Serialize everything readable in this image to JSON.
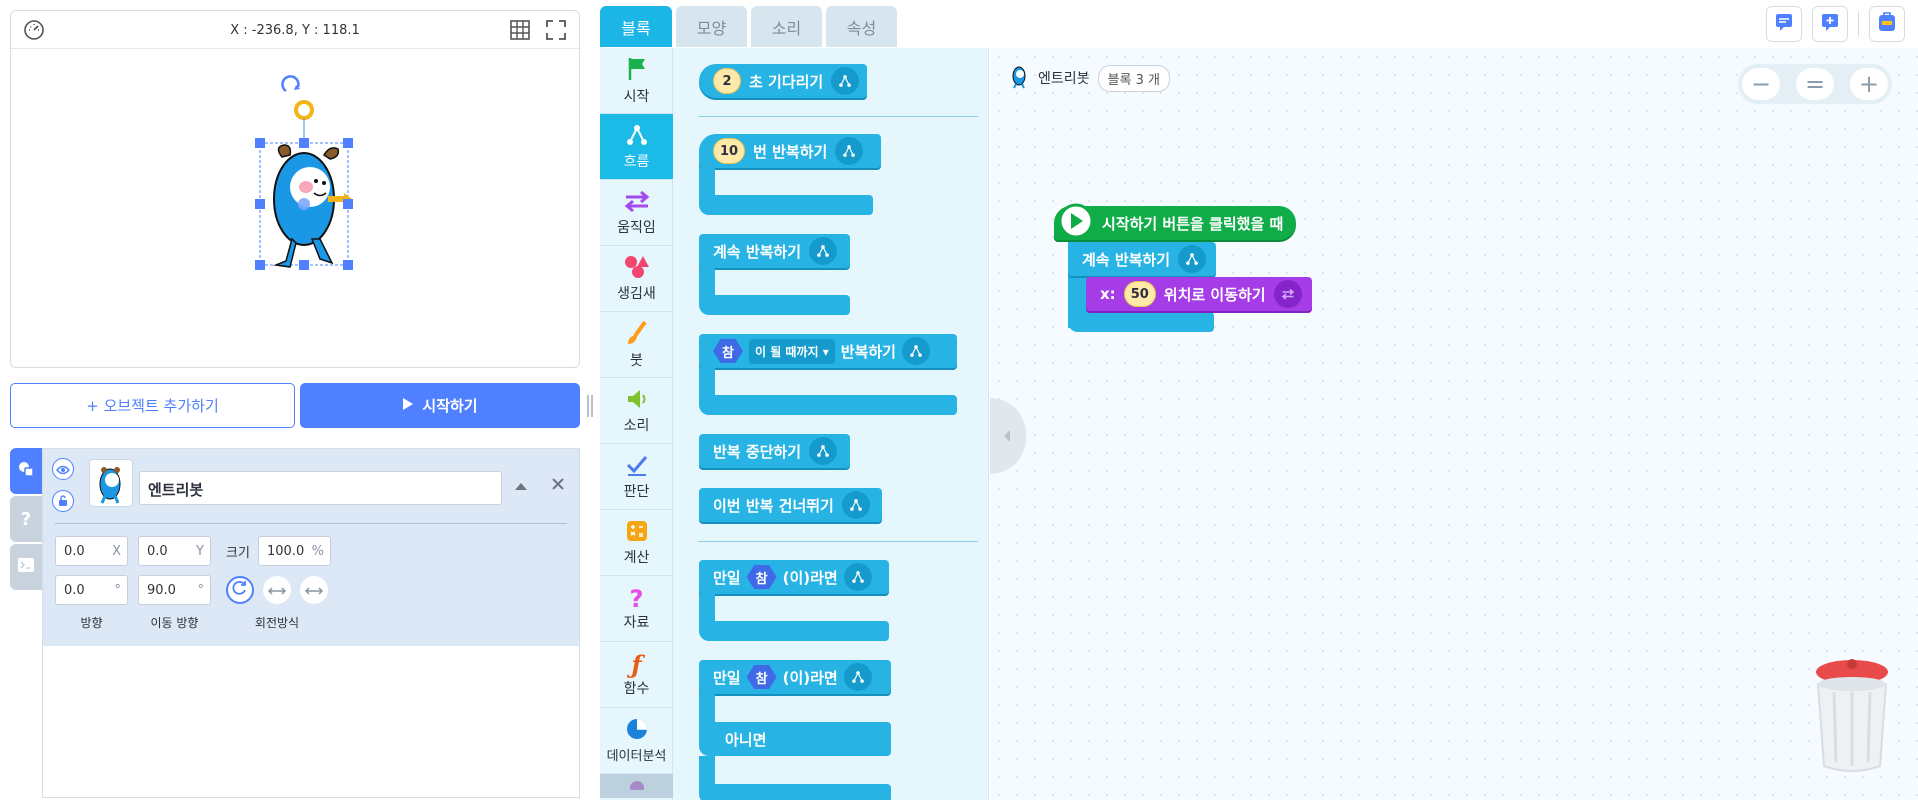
{
  "stage": {
    "coordinates": "X : -236.8, Y : 118.1"
  },
  "buttons": {
    "add_object": "+ 오브젝트 추가하기",
    "start": "시작하기"
  },
  "object": {
    "name": "엔트리봇",
    "x": "0.0",
    "x_unit": "X",
    "y": "0.0",
    "y_unit": "Y",
    "size_label": "크기",
    "size": "100.0",
    "size_unit": "%",
    "direction": "0.0",
    "direction_unit": "°",
    "move_direction": "90.0",
    "move_direction_unit": "°",
    "labels": {
      "direction": "방향",
      "move_direction": "이동 방향",
      "rotation": "회전방식"
    },
    "side_tab_help": "?"
  },
  "tabs": [
    {
      "label": "블록",
      "active": true
    },
    {
      "label": "모양",
      "active": false
    },
    {
      "label": "소리",
      "active": false
    },
    {
      "label": "속성",
      "active": false
    }
  ],
  "categories": [
    {
      "label": "시작",
      "icon": "flag-icon",
      "color": "#1bb14b"
    },
    {
      "label": "흐름",
      "icon": "flow-icon",
      "color": "#ffffff",
      "active": true
    },
    {
      "label": "움직임",
      "icon": "arrows-icon",
      "color": "#a24cf0"
    },
    {
      "label": "생김새",
      "icon": "shapes-icon",
      "color": "#f2466f"
    },
    {
      "label": "붓",
      "icon": "brush-icon",
      "color": "#ff9b1a"
    },
    {
      "label": "소리",
      "icon": "speaker-icon",
      "color": "#80c12e"
    },
    {
      "label": "판단",
      "icon": "check-icon",
      "color": "#4b7bec"
    },
    {
      "label": "계산",
      "icon": "calculator-icon",
      "color": "#f4a614"
    },
    {
      "label": "자료",
      "icon": "question-icon",
      "color": "#e34de8"
    },
    {
      "label": "함수",
      "icon": "function-icon",
      "color": "#e85d14"
    },
    {
      "label": "데이터분석",
      "icon": "pie-icon",
      "color": "#1a82d8"
    }
  ],
  "palette": {
    "wait": {
      "value": "2",
      "text": "초 기다리기"
    },
    "repeat_n": {
      "value": "10",
      "text": "번 반복하기"
    },
    "repeat_forever": {
      "text": "계속 반복하기"
    },
    "repeat_until": {
      "cond": "참",
      "dropdown": "이 될 때까지 ▾",
      "text": "반복하기"
    },
    "stop_repeat": {
      "text": "반복 중단하기"
    },
    "skip_repeat": {
      "text": "이번 반복 건너뛰기"
    },
    "if": {
      "prefix": "만일",
      "cond": "참",
      "suffix": "(이)라면"
    },
    "if_else": {
      "prefix": "만일",
      "cond": "참",
      "suffix": "(이)라면",
      "else": "아니면"
    }
  },
  "workspace": {
    "object_name": "엔트리봇",
    "block_count": "블록 3 개",
    "script": {
      "hat": "시작하기 버튼을 클릭했을 때",
      "loop": "계속 반복하기",
      "move_prefix": "x:",
      "move_value": "50",
      "move_suffix": "위치로 이동하기"
    },
    "zoom": {
      "out": "−",
      "reset": "=",
      "in": "+"
    }
  }
}
